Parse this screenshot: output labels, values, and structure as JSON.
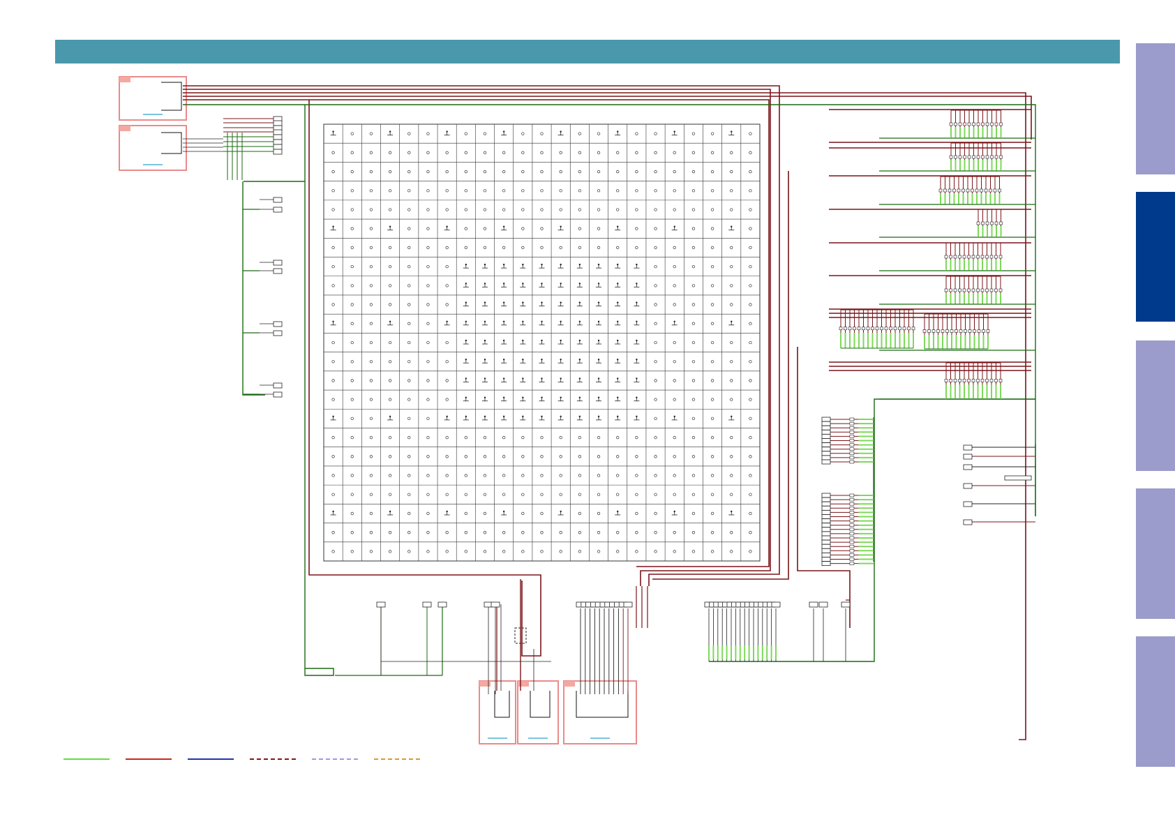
{
  "header": {
    "color": "#4a98ab"
  },
  "side_tabs": [
    {
      "id": "tab-1",
      "active": false
    },
    {
      "id": "tab-2",
      "active": true
    },
    {
      "id": "tab-3",
      "active": false
    },
    {
      "id": "tab-4",
      "active": false
    },
    {
      "id": "tab-5",
      "active": false
    }
  ],
  "colors": {
    "tab_inactive": "#9b9ccb",
    "tab_active": "#003a8c",
    "trace_red": "#7a1418",
    "trace_green": "#1a6a12",
    "pad_green": "#7dd95a",
    "grid_line": "#333333",
    "connector_box": "#ea8a8a",
    "connector_fill": "#f4a8a0",
    "link_blue": "#2aa0c8"
  },
  "bga": {
    "rows": 23,
    "cols": 23
  },
  "legend": [
    {
      "name": "legend-green-solid",
      "color": "#5fe03a",
      "style": "solid"
    },
    {
      "name": "legend-red-solid",
      "color": "#c8281e",
      "style": "solid"
    },
    {
      "name": "legend-blue-solid",
      "color": "#1f35b0",
      "style": "solid"
    },
    {
      "name": "legend-darkred-dashed",
      "color": "#8a1414",
      "style": "dashed"
    },
    {
      "name": "legend-lavender-dashed",
      "color": "#9b9ae0",
      "style": "dashed"
    },
    {
      "name": "legend-orange-dashed",
      "color": "#d99a30",
      "style": "dashed"
    }
  ],
  "connectors": [
    {
      "id": "conn-top-left-1"
    },
    {
      "id": "conn-top-left-2"
    },
    {
      "id": "conn-bottom-1"
    },
    {
      "id": "conn-bottom-2"
    },
    {
      "id": "conn-bottom-3"
    }
  ]
}
